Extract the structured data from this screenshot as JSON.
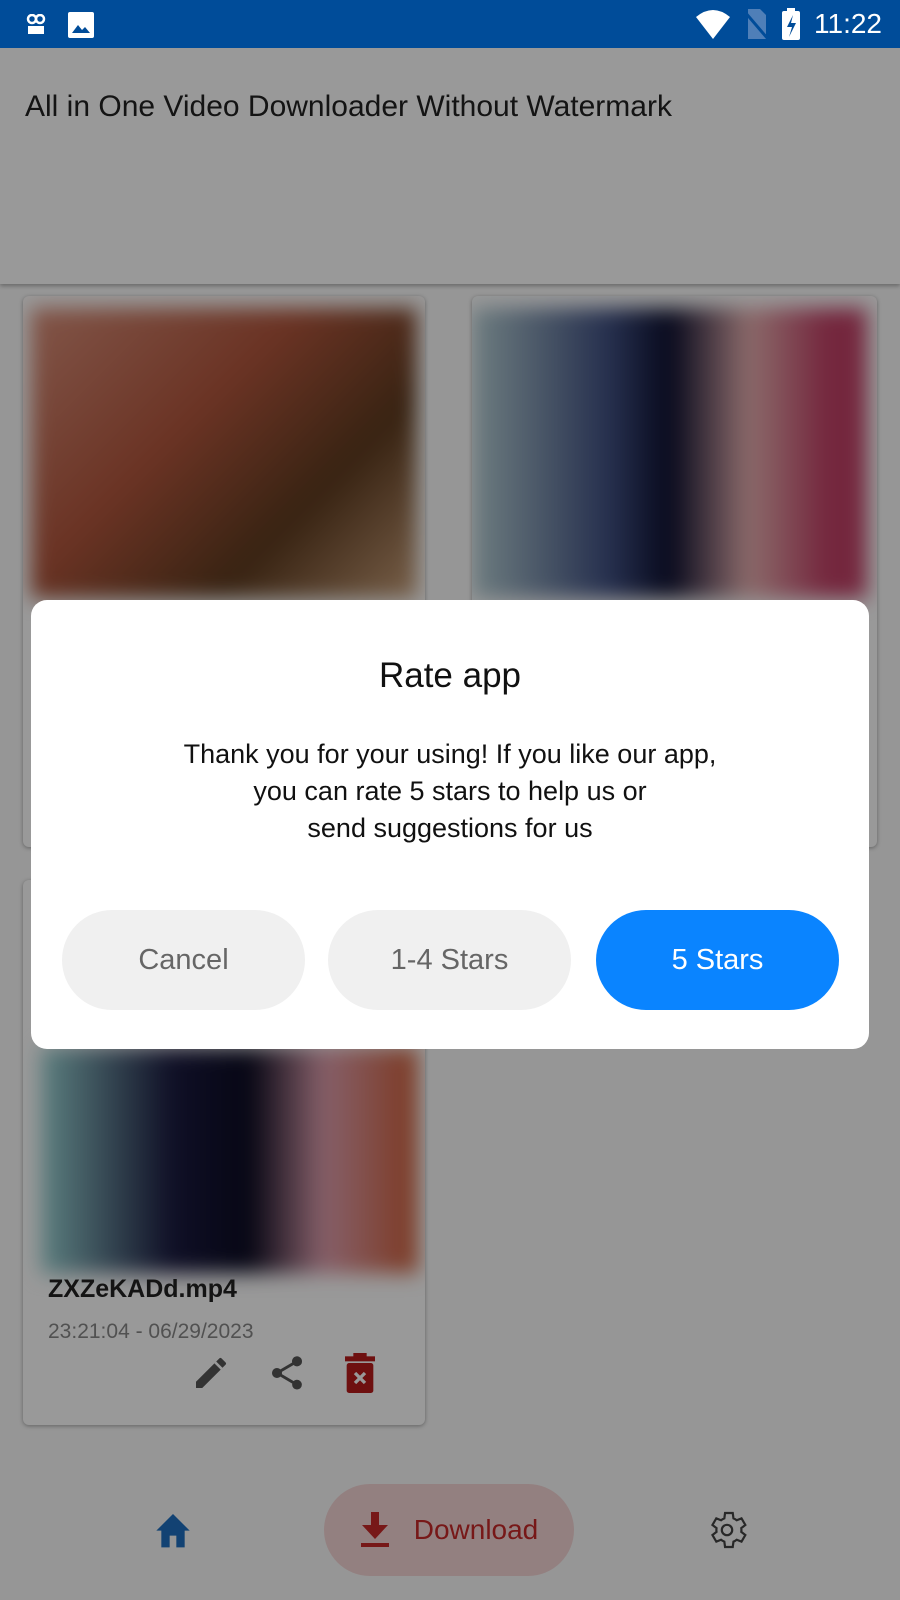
{
  "status_bar": {
    "time": "11:22",
    "icons": [
      "voicemail-icon",
      "image-icon",
      "wifi-icon",
      "no-sim-icon",
      "battery-charging-icon"
    ]
  },
  "app_bar": {
    "title": "All in One Video Downloader Without Watermark"
  },
  "videos": [
    {
      "filename": "",
      "date": ""
    },
    {
      "filename": "",
      "date": ""
    },
    {
      "filename": "ZXZeKADd.mp4",
      "date": "23:21:04 - 06/29/2023",
      "actions": [
        "edit-icon",
        "share-icon",
        "delete-icon"
      ]
    }
  ],
  "dialog": {
    "title": "Rate app",
    "message_lines": [
      "Thank you for your using!  If you like our app,",
      "you can rate 5 stars to help us or",
      "send suggestions for us"
    ],
    "cancel": "Cancel",
    "low": "1-4 Stars",
    "five": "5 Stars"
  },
  "bottom_nav": {
    "download": "Download",
    "items": [
      "home-icon",
      "download-icon",
      "settings-icon"
    ]
  },
  "colors": {
    "status_bar": "#004c99",
    "accent": "#0a84ff",
    "download": "#c62828",
    "home": "#1e6fc0"
  }
}
